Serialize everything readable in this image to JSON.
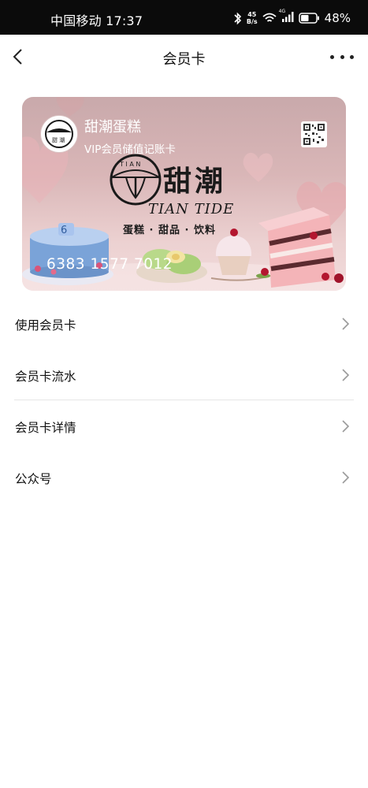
{
  "status_bar": {
    "carrier_time": "中国移动 17:37",
    "net_speed_value": "45",
    "net_speed_unit": "B/s",
    "network_type": "4G",
    "battery": "48%",
    "icons": [
      "bluetooth-icon",
      "wifi-icon",
      "signal-icon",
      "battery-icon"
    ]
  },
  "nav": {
    "title": "会员卡",
    "back_icon": "chevron-left-icon",
    "more_icon": "more-dots-icon"
  },
  "card": {
    "store_name": "甜潮蛋糕",
    "subtitle": "VIP会员储值记账卡",
    "logo_text_top": "TIAN",
    "logo_text_chars": "甜 潮",
    "brand_logo_top": "T I A N",
    "brand_main": "甜潮",
    "brand_en": "TIAN TIDE",
    "brand_tagline": "蛋糕 · 甜品 · 饮料",
    "cake_topper": "6",
    "card_number": "6383 1577 7012",
    "qr_icon": "qr-code-icon"
  },
  "menu": {
    "items": [
      {
        "label": "使用会员卡"
      },
      {
        "label": "会员卡流水"
      },
      {
        "label": "会员卡详情"
      },
      {
        "label": "公众号"
      }
    ],
    "chevron_icon": "chevron-right-icon"
  }
}
